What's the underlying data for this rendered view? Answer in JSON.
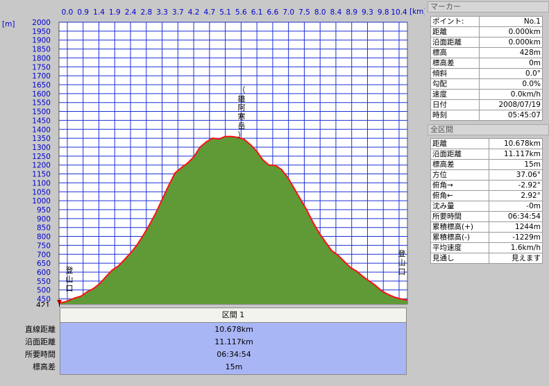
{
  "axis": {
    "x_unit": "[km]",
    "y_unit": "[m]",
    "x_ticks": [
      "0.0",
      "0.9",
      "1.4",
      "1.9",
      "2.4",
      "2.8",
      "3.3",
      "3.7",
      "4.2",
      "4.7",
      "5.1",
      "5.6",
      "6.1",
      "6.6",
      "7.0",
      "7.5",
      "8.0",
      "8.4",
      "8.9",
      "9.3",
      "9.8",
      "10.4"
    ],
    "y_ticks": [
      "2000",
      "1950",
      "1900",
      "1850",
      "1800",
      "1750",
      "1700",
      "1650",
      "1600",
      "1550",
      "1500",
      "1450",
      "1400",
      "1350",
      "1300",
      "1250",
      "1200",
      "1150",
      "1100",
      "1050",
      "1000",
      "950",
      "900",
      "850",
      "800",
      "750",
      "700",
      "650",
      "600",
      "550",
      "500",
      "450"
    ],
    "y_min_label": "421"
  },
  "colors": {
    "plot_bg": "#ffffff",
    "grid": "#1c2fd6",
    "fill": "#5f9a36",
    "line": "#ff1010",
    "section_body": "#a9b6f5"
  },
  "annotations": {
    "start": "登山口",
    "peak": "（雄阿寒岳）",
    "end": "登山口"
  },
  "chart_data": {
    "type": "area",
    "title": "",
    "xlabel": "[km]",
    "ylabel": "[m]",
    "xlim": [
      0,
      11.117
    ],
    "ylim": [
      421,
      2000
    ],
    "series": [
      {
        "x": [
          0,
          0.15,
          0.3,
          0.5,
          0.7,
          0.9,
          1.1,
          1.3,
          1.5,
          1.7,
          1.9,
          2.1,
          2.3,
          2.5,
          2.7,
          2.9,
          3.1,
          3.3,
          3.5,
          3.7,
          3.9,
          4.1,
          4.3,
          4.5,
          4.7,
          4.9,
          5.1,
          5.3,
          5.5,
          5.7,
          5.9,
          6.1,
          6.3,
          6.5,
          6.7,
          6.9,
          7.1,
          7.3,
          7.5,
          7.7,
          7.9,
          8.1,
          8.3,
          8.5,
          8.7,
          8.9,
          9.1,
          9.3,
          9.5,
          9.7,
          9.9,
          10.1,
          10.3,
          10.5,
          10.7,
          10.9,
          11.117
        ],
        "y": [
          428,
          431,
          440,
          455,
          465,
          490,
          508,
          535,
          575,
          612,
          635,
          672,
          710,
          755,
          810,
          870,
          935,
          1010,
          1085,
          1155,
          1185,
          1210,
          1245,
          1300,
          1330,
          1350,
          1345,
          1360,
          1360,
          1355,
          1345,
          1315,
          1280,
          1230,
          1200,
          1198,
          1175,
          1130,
          1070,
          1010,
          950,
          880,
          820,
          770,
          720,
          695,
          660,
          625,
          605,
          575,
          550,
          525,
          495,
          475,
          460,
          450,
          443
        ]
      }
    ]
  },
  "section": {
    "header": "区間 1",
    "rows": [
      {
        "label": "直線距離",
        "value": "10.678km"
      },
      {
        "label": "沿面距離",
        "value": "11.117km"
      },
      {
        "label": "所要時間",
        "value": "06:34:54"
      },
      {
        "label": "標高差",
        "value": "15m"
      }
    ]
  },
  "marker_panel": {
    "title": "マーカー",
    "rows": [
      {
        "label": "ポイント:",
        "value": "No.1"
      },
      {
        "label": "距離",
        "value": "0.000km"
      },
      {
        "label": "沿面距離",
        "value": "0.000km"
      },
      {
        "label": "標高",
        "value": "428m"
      },
      {
        "label": "標高差",
        "value": "0m"
      },
      {
        "label": "傾斜",
        "value": "0.0°"
      },
      {
        "label": "勾配",
        "value": "0.0%"
      },
      {
        "label": "速度",
        "value": "0.0km/h"
      },
      {
        "label": "日付",
        "value": "2008/07/19"
      },
      {
        "label": "時刻",
        "value": "05:45:07"
      }
    ]
  },
  "all_panel": {
    "title": "全区間",
    "rows": [
      {
        "label": "距離",
        "value": "10.678km"
      },
      {
        "label": "沿面距離",
        "value": "11.117km"
      },
      {
        "label": "標高差",
        "value": "15m"
      },
      {
        "label": "方位",
        "value": "37.06°"
      },
      {
        "label": "俯角→",
        "value": "-2.92°"
      },
      {
        "label": "俯角←",
        "value": "2.92°"
      },
      {
        "label": "沈み量",
        "value": "-0m"
      },
      {
        "label": "所要時間",
        "value": "06:34:54"
      },
      {
        "label": "累積標高(+)",
        "value": "1244m"
      },
      {
        "label": "累積標高(-)",
        "value": "-1229m"
      },
      {
        "label": "平均速度",
        "value": "1.6km/h"
      },
      {
        "label": "見通し",
        "value": "見えます"
      }
    ]
  }
}
